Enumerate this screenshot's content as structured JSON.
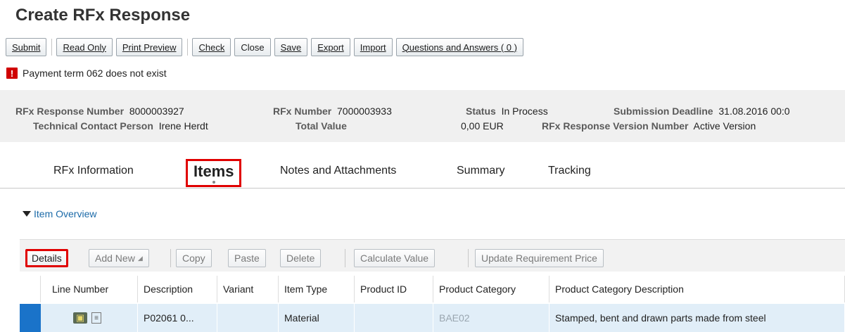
{
  "page_title": "Create RFx Response",
  "toolbar": {
    "submit": "Submit",
    "read_only": "Read Only",
    "print_preview": "Print Preview",
    "check": "Check",
    "close": "Close",
    "save": "Save",
    "export": "Export",
    "import": "Import",
    "qa": "Questions and Answers ( 0 )"
  },
  "message": {
    "icon": "!",
    "text": "Payment term 062 does not exist",
    "color": "#d00000"
  },
  "header": {
    "response_number_label": "RFx Response Number",
    "response_number": "8000003927",
    "rfx_number_label": "RFx Number",
    "rfx_number": "7000003933",
    "status_label": "Status",
    "status": "In Process",
    "deadline_label": "Submission Deadline",
    "deadline": "31.08.2016 00:0",
    "contact_label": "Technical Contact Person",
    "contact": "Irene Herdt",
    "total_label": "Total Value",
    "total": "0,00 EUR",
    "version_label": "RFx Response Version Number",
    "version": "Active Version"
  },
  "tabs": {
    "rfx_information": "RFx Information",
    "items": "Items",
    "notes": "Notes and Attachments",
    "summary": "Summary",
    "tracking": "Tracking"
  },
  "section": {
    "title": "Item Overview"
  },
  "grid_toolbar": {
    "details": "Details",
    "add_new": "Add New",
    "copy": "Copy",
    "paste": "Paste",
    "delete": "Delete",
    "calculate_value": "Calculate Value",
    "update_price": "Update Requirement Price"
  },
  "table": {
    "headers": {
      "line_number": "Line Number",
      "description": "Description",
      "variant": "Variant",
      "item_type": "Item Type",
      "product_id": "Product ID",
      "product_category": "Product Category",
      "category_description": "Product Category Description"
    },
    "rows": [
      {
        "line_number": "",
        "description": "P02061 0...",
        "variant": "",
        "item_type": "Material",
        "product_id": "",
        "product_category": "BAE02",
        "category_description": "Stamped, bent and drawn parts made from steel"
      }
    ]
  },
  "colors": {
    "accent": "#1a73c9",
    "highlight": "#e00000",
    "row_selected": "#e1eef8"
  }
}
